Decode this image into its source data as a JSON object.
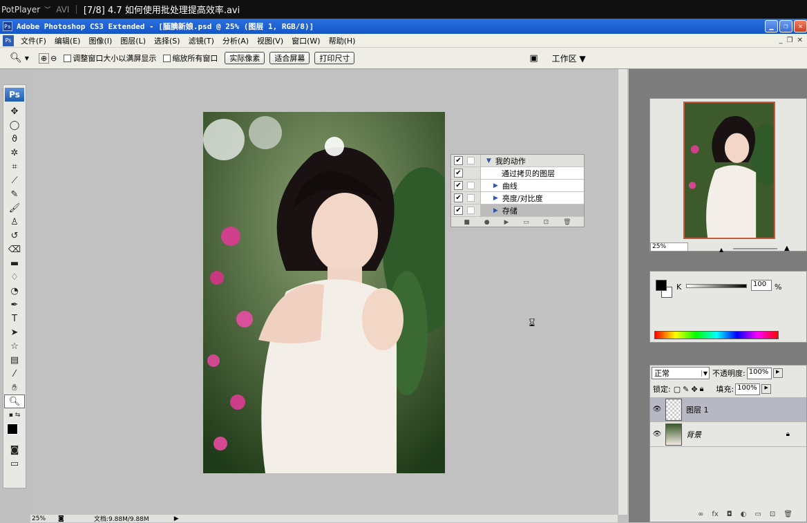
{
  "player": {
    "name": "PotPlayer",
    "format": "AVI",
    "title": "[7/8] 4.7 如何使用批处理提高效率.avi"
  },
  "ps": {
    "window_title": "Adobe Photoshop CS3 Extended - [腼腆新娘.psd @ 25% (图层 1, RGB/8)]",
    "logo": "Ps"
  },
  "menu": {
    "items": [
      "文件(F)",
      "编辑(E)",
      "图像(I)",
      "图层(L)",
      "选择(S)",
      "滤镜(T)",
      "分析(A)",
      "视图(V)",
      "窗口(W)",
      "帮助(H)"
    ]
  },
  "options": {
    "fit_window": "调整窗口大小以满屏显示",
    "zoom_all": "缩放所有窗口",
    "actual_pixels": "实际像素",
    "fit_screen": "适合屏幕",
    "print_size": "打印尺寸",
    "workspace": "工作区 ▼"
  },
  "actions": {
    "rows": [
      {
        "label": "我的动作",
        "expanded": true
      },
      {
        "label": "通过拷贝的图层",
        "expanded": false
      },
      {
        "label": "曲线",
        "expanded": false
      },
      {
        "label": "亮度/对比度",
        "expanded": false
      },
      {
        "label": "存储",
        "expanded": false,
        "selected": true
      }
    ]
  },
  "navigator": {
    "zoom": "25%"
  },
  "color": {
    "channel": "K",
    "value": "100",
    "unit": "%"
  },
  "layers": {
    "blend_mode": "正常",
    "opacity_label": "不透明度:",
    "opacity": "100%",
    "lock_label": "锁定:",
    "fill_label": "填充:",
    "fill": "100%",
    "items": [
      {
        "name": "图层 1",
        "selected": true
      },
      {
        "name": "背景",
        "locked": true
      }
    ]
  },
  "status": {
    "zoom": "25%",
    "doc": "文档:9.88M/9.88M"
  },
  "colors": {
    "accent_title": "#1556c8",
    "selection_frame": "#c85a3a"
  }
}
